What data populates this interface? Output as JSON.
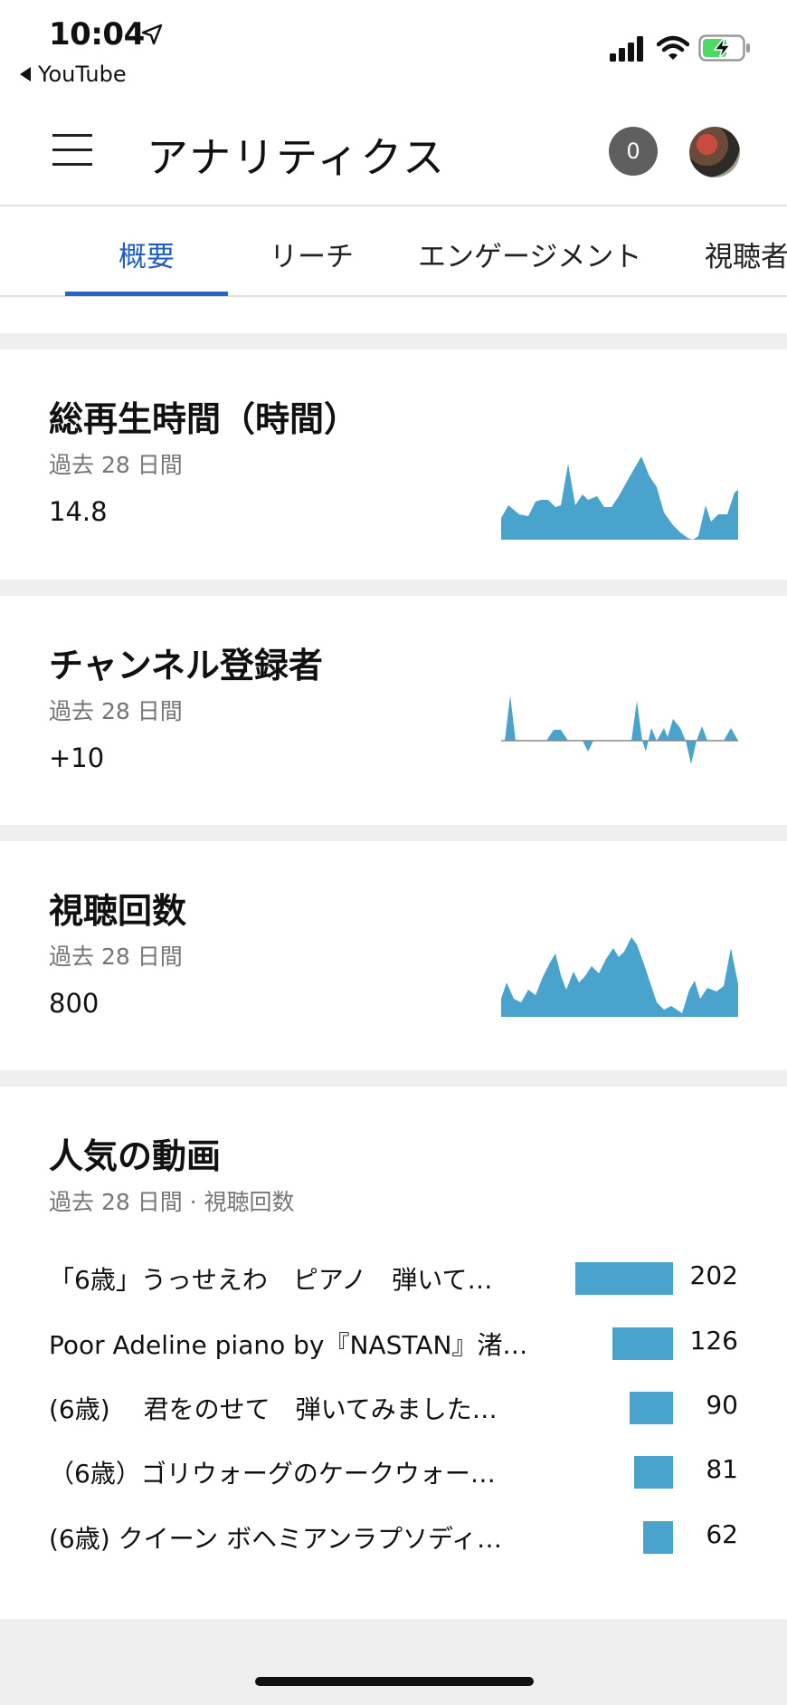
{
  "status_bar": {
    "time": "10:04",
    "back_label": "YouTube"
  },
  "header": {
    "title": "アナリティクス",
    "notification_count": "0"
  },
  "tabs": [
    {
      "label": "概要",
      "active": true
    },
    {
      "label": "リーチ",
      "active": false
    },
    {
      "label": "エンゲージメント",
      "active": false
    },
    {
      "label": "視聴者",
      "active": false
    }
  ],
  "cards": {
    "watch_time": {
      "title": "総再生時間（時間）",
      "period": "過去 28 日間",
      "value": "14.8"
    },
    "subscribers": {
      "title": "チャンネル登録者",
      "period": "過去 28 日間",
      "value": "+10"
    },
    "views": {
      "title": "視聴回数",
      "period": "過去 28 日間",
      "value": "800"
    }
  },
  "popular": {
    "title": "人気の動画",
    "subtitle": "過去 28 日間 · 視聴回数",
    "videos": [
      {
        "title": "「6歳」うっせえわ　ピアノ　弾いて…",
        "views": "202"
      },
      {
        "title": "Poor Adeline piano by『NASTAN』渚…",
        "views": "126"
      },
      {
        "title": "(6歳)　 君をのせて　弾いてみました…",
        "views": "90"
      },
      {
        "title": "（6歳）ゴリウォーグのケークウォー…",
        "views": "81"
      },
      {
        "title": "(6歳)  クイーン ボヘミアンラプソディ…",
        "views": "62"
      }
    ],
    "bar_max": 202
  },
  "colors": {
    "accent": "#2766c8",
    "spark": "#4aa3cc",
    "badge": "#5f5f5f",
    "separator": "#efefef"
  },
  "icons": [
    "location-arrow-icon",
    "back-triangle-icon",
    "cellular-signal-icon",
    "wifi-icon",
    "battery-charging-icon",
    "hamburger-menu-icon"
  ]
}
